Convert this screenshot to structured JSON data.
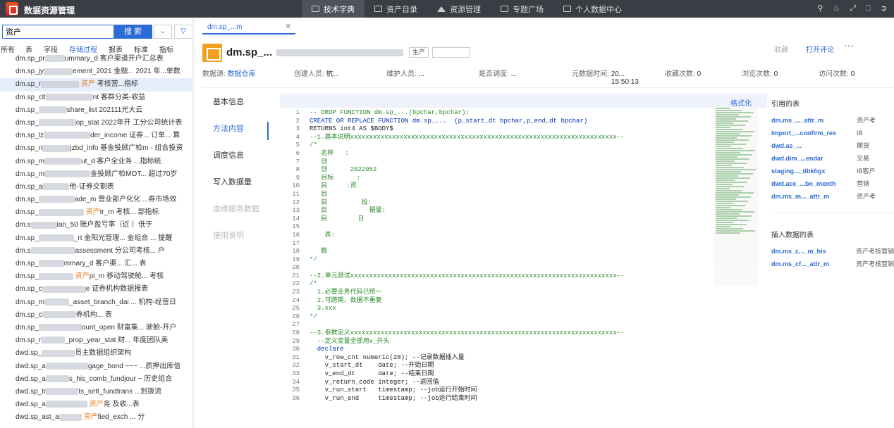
{
  "app": {
    "title": "数据资源管理"
  },
  "nav": [
    {
      "label": "技术字典",
      "icon": "book-icon",
      "active": true
    },
    {
      "label": "资产目录",
      "icon": "catalog-icon",
      "active": false
    },
    {
      "label": "资源管理",
      "icon": "home-icon",
      "active": false
    },
    {
      "label": "专题广场",
      "icon": "grid-icon",
      "active": false
    },
    {
      "label": "个人数据中心",
      "icon": "grid-icon",
      "active": false
    }
  ],
  "top_icons": [
    "search-icon",
    "bell-icon",
    "fullscreen-icon",
    "lock-icon",
    "logout-icon"
  ],
  "search": {
    "value": "资产",
    "button": "搜 索"
  },
  "categories": [
    {
      "label": "所有",
      "active": false
    },
    {
      "label": "表",
      "active": false
    },
    {
      "label": "字段",
      "active": false
    },
    {
      "label": "存储过程",
      "active": true
    },
    {
      "label": "报表",
      "active": false
    },
    {
      "label": "标准",
      "active": false
    },
    {
      "label": "指标",
      "active": false
    }
  ],
  "results": [
    {
      "prefix": "dm.sp_pr",
      "suffix": "ummary_d 客户渠道开户汇总表",
      "hl": ""
    },
    {
      "prefix": "dm.sp_jy",
      "suffix": "ement_2021 金融... 2021 年...单数",
      "hl": ""
    },
    {
      "prefix": "dm.sp_r",
      "suffix": " 考核营...指标",
      "hl": "资产",
      "selected": true
    },
    {
      "prefix": "dm.sp_clt",
      "suffix": "nt 客群分类-收益",
      "hl": ""
    },
    {
      "prefix": "dm.sp_",
      "suffix": "share_list 202111光大云",
      "hl": ""
    },
    {
      "prefix": "dm.sp_",
      "suffix": "op_stat 2022年开 工分公司统计表",
      "hl": ""
    },
    {
      "prefix": "dm.sp_lz",
      "suffix": "der_income 证券... 订单... 算",
      "hl": ""
    },
    {
      "prefix": "dm.sp_n",
      "suffix": "jzbd_info 基金投顾广检m - 组合投资",
      "hl": ""
    },
    {
      "prefix": "dm.sp_m",
      "suffix": "ut_d 客户全业务 ...指标统",
      "hl": ""
    },
    {
      "prefix": "dm.sp_m",
      "suffix": "金投顾广检MOT... 超过70岁",
      "hl": ""
    },
    {
      "prefix": "dm.sp_a",
      "suffix": "他-证券交割表",
      "hl": ""
    },
    {
      "prefix": "dm.sp_",
      "suffix": "ade_m 营业部产化化 ...券市场效",
      "hl": ""
    },
    {
      "prefix": "dm.sp_",
      "suffix": "tr_m  考核... 部指标",
      "hl": "资产"
    },
    {
      "prefix": "dm.s",
      "suffix": "ian_50 账户盈亏率（近 ）低于",
      "hl": ""
    },
    {
      "prefix": "dm.sp_",
      "suffix": "_rt 金阳光管理... 金组合 ... 提醒",
      "hl": ""
    },
    {
      "prefix": "dm.s",
      "suffix": "assessment 分公司考核... 户",
      "hl": ""
    },
    {
      "prefix": "dm.sp_",
      "suffix": "mmary_d 客户渠... 汇... 表",
      "hl": ""
    },
    {
      "prefix": "dm.sp_",
      "suffix": "pi_m 移动驾驶舱... 考核",
      "hl": "资产"
    },
    {
      "prefix": "dm.sp_c",
      "suffix": "e 证券机构数据报表",
      "hl": ""
    },
    {
      "prefix": "dm.sp_m",
      "suffix": "_asset_branch_dai ... 机构-经营日",
      "hl": ""
    },
    {
      "prefix": "dm.sp_c",
      "suffix": "券机构... 表",
      "hl": ""
    },
    {
      "prefix": "dm.sp_",
      "suffix": "ount_open 财富集... 驶舱-开户",
      "hl": ""
    },
    {
      "prefix": "dm.sp_r",
      "suffix": "_prop_year_stat 财... 年度团队美",
      "hl": ""
    },
    {
      "prefix": "dwd.sp_",
      "suffix": "员主数据组织架构",
      "hl": ""
    },
    {
      "prefix": "dwd.sp_a",
      "suffix": "gage_bond ~~~ ...质押出库信",
      "hl": ""
    },
    {
      "prefix": "dwd.sp_a",
      "suffix": "s_his_comb_fundjour ~ 历史组合",
      "hl": ""
    },
    {
      "prefix": "dwd.sp_tr",
      "suffix": "ts_sett_fundtrans ...划拨流",
      "hl": ""
    },
    {
      "prefix": "dwd.sp_a",
      "suffix": "务  及收...表",
      "hl": "资产"
    },
    {
      "prefix": "dwd.sp_ast_a",
      "suffix": "fied_exch ... 分",
      "hl": "资产"
    }
  ],
  "detail": {
    "tab_label": "dm.sp_...m",
    "obj_name": "dm.sp_...",
    "env_badge": "生产",
    "collect": "收藏",
    "review": "打开评论",
    "more": "···",
    "meta": [
      {
        "label": "数据源:",
        "value": "数据仓库"
      },
      {
        "label": "创建人员:",
        "value": "杭..."
      },
      {
        "label": "维护人员:",
        "value": "..."
      },
      {
        "label": "是否调度:",
        "value": "..."
      },
      {
        "label": "元数据时间:",
        "value": "20... "
      },
      {
        "label": "收藏次数:",
        "value": "0"
      },
      {
        "label": "浏览次数:",
        "value": "0"
      },
      {
        "label": "访问次数:",
        "value": "0"
      }
    ],
    "meta_time2": "15:50:13"
  },
  "left_nav": [
    {
      "label": "基本信息",
      "active": false,
      "dim": false
    },
    {
      "label": "方法内容",
      "active": true,
      "dim": false
    },
    {
      "label": "调度信息",
      "active": false,
      "dim": false
    },
    {
      "label": "写入数据量",
      "active": false,
      "dim": false
    },
    {
      "label": "血缘服务数据",
      "active": false,
      "dim": true
    },
    {
      "label": "使用说明",
      "active": false,
      "dim": true
    }
  ],
  "code": {
    "format_label": "格式化",
    "lines": [
      {
        "n": "1",
        "t": "-- DROP FUNCTION dm.sp_...(bpchar,bpchar);",
        "c": "cm"
      },
      {
        "n": "2",
        "t": "CREATE OR REPLACE FUNCTION dm.sp_...  (p_start_dt bpchar,p_end_dt bpchar)",
        "c": "kw"
      },
      {
        "n": "3",
        "t": "RETURNS int4 AS $BODY$",
        "c": "ct"
      },
      {
        "n": "4",
        "t": "--1.基本说明xxxxxxxxxxxxxxxxxxxxxxxxxxxxxxxxxxxxxxxxxxxxxxxxxxxxxxxxxxxxxxxxxxxxxx--",
        "c": "cm"
      },
      {
        "n": "5",
        "t": "/*",
        "c": "cm"
      },
      {
        "n": "6",
        "t": "   名称   :",
        "c": "cm"
      },
      {
        "n": "7",
        "t": "   创",
        "c": "cm"
      },
      {
        "n": "8",
        "t": "   创      2022052",
        "c": "cm"
      },
      {
        "n": "9",
        "t": "   目标      :",
        "c": "cm"
      },
      {
        "n": "10",
        "t": "   目     :资",
        "c": "cm"
      },
      {
        "n": "11",
        "t": "   目",
        "c": "cm"
      },
      {
        "n": "12",
        "t": "   目         段:",
        "c": "cm"
      },
      {
        "n": "13",
        "t": "   目           据量:",
        "c": "cm"
      },
      {
        "n": "14",
        "t": "   目        日",
        "c": "cm"
      },
      {
        "n": "15",
        "t": "",
        "c": "cm"
      },
      {
        "n": "16",
        "t": "    表:",
        "c": "cm"
      },
      {
        "n": "17",
        "t": "",
        "c": "cm"
      },
      {
        "n": "18",
        "t": "   数",
        "c": "cm"
      },
      {
        "n": "19",
        "t": "*/",
        "c": "cm"
      },
      {
        "n": "20",
        "t": "",
        "c": "ct"
      },
      {
        "n": "21",
        "t": "--2.单元测试xxxxxxxxxxxxxxxxxxxxxxxxxxxxxxxxxxxxxxxxxxxxxxxxxxxxxxxxxxxxxxxxxxxxxx--",
        "c": "cm"
      },
      {
        "n": "22",
        "t": "/*",
        "c": "cm"
      },
      {
        "n": "23",
        "t": "  1.必要业务代码已统一",
        "c": "cm"
      },
      {
        "n": "24",
        "t": "  2.可跨期，数据不重复",
        "c": "cm"
      },
      {
        "n": "25",
        "t": "  3.xxx",
        "c": "cm"
      },
      {
        "n": "26",
        "t": "*/",
        "c": "cm"
      },
      {
        "n": "27",
        "t": "",
        "c": "ct"
      },
      {
        "n": "28",
        "t": "--3.参数定义xxxxxxxxxxxxxxxxxxxxxxxxxxxxxxxxxxxxxxxxxxxxxxxxxxxxxxxxxxxxxxxxxxxxxx--",
        "c": "cm"
      },
      {
        "n": "29",
        "t": "  --定义变量全部用v_开头",
        "c": "cm"
      },
      {
        "n": "30",
        "t": "  declare",
        "c": "kw"
      },
      {
        "n": "31",
        "t": "    v_row_cnt numeric(28); --记录数据插入量",
        "c": "ct"
      },
      {
        "n": "32",
        "t": "    v_start_dt    date; --开始日期",
        "c": "ct"
      },
      {
        "n": "33",
        "t": "    v_end_dt      date; --结束日期",
        "c": "ct"
      },
      {
        "n": "34",
        "t": "    v_return_code integer; --返回值",
        "c": "ct"
      },
      {
        "n": "35",
        "t": "    v_run_start   timestamp; --job运行开始时间",
        "c": "ct"
      },
      {
        "n": "36",
        "t": "    v_run_end     timestamp; --job运行结束时间",
        "c": "ct"
      }
    ]
  },
  "refs": {
    "title": "引用的表",
    "items": [
      {
        "name": "dm.ms_..._attr_m",
        "desc": "资产考"
      },
      {
        "name": "import_...confirm_res",
        "desc": "IB"
      },
      {
        "name": "dwd.as_...",
        "desc": "期货"
      },
      {
        "name": "dwd.dim_...endar",
        "desc": "交易"
      },
      {
        "name": "staging..._tibkhgx",
        "desc": "IB客户"
      },
      {
        "name": "dwd.acc_...bn_month",
        "desc": "营销"
      },
      {
        "name": "dm.ms_m..._attr_m",
        "desc": "资产考"
      }
    ],
    "insert_title": "插入数据的表",
    "insert_items": [
      {
        "name": "dm.ms_c..._m_his",
        "desc": "资产考核营销"
      },
      {
        "name": "dm.ms_cf..._attr_m",
        "desc": "资产考核营销"
      }
    ]
  },
  "colors": {
    "accent": "#2d6bd6",
    "topbar": "#3a3d44",
    "highlight": "#e67e22"
  }
}
